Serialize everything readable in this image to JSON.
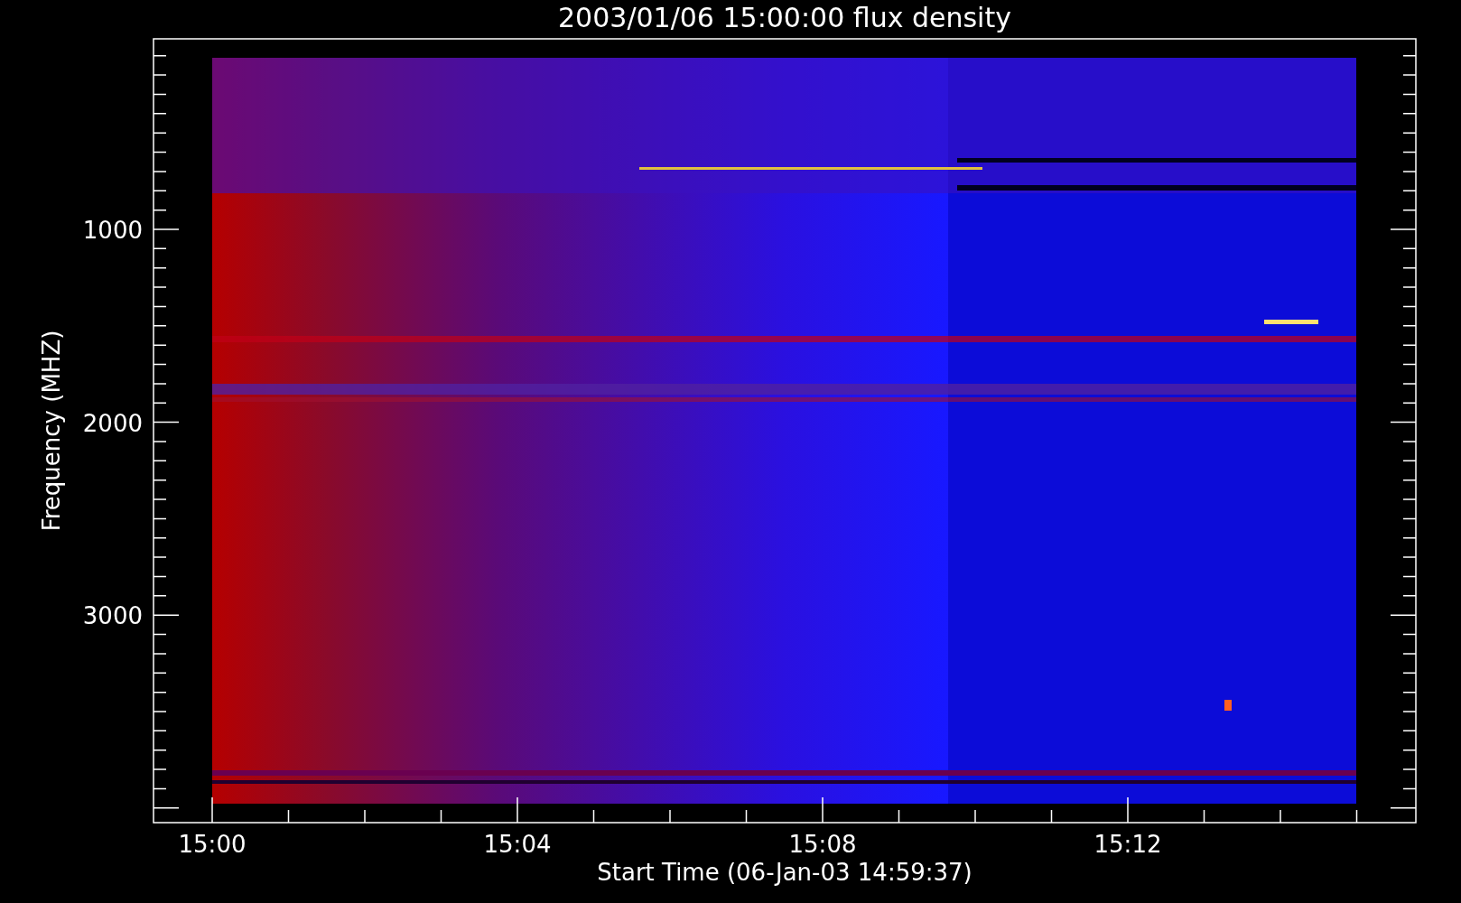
{
  "plot": {
    "title": "2003/01/06 15:00:00 flux density",
    "xlabel": "Start Time (06-Jan-03 14:59:37)",
    "ylabel": "Frequency (MHZ)",
    "x_tick_labels": [
      "15:00",
      "15:04",
      "15:08",
      "15:12"
    ],
    "y_tick_labels": [
      "1000",
      "2000",
      "3000"
    ]
  }
}
